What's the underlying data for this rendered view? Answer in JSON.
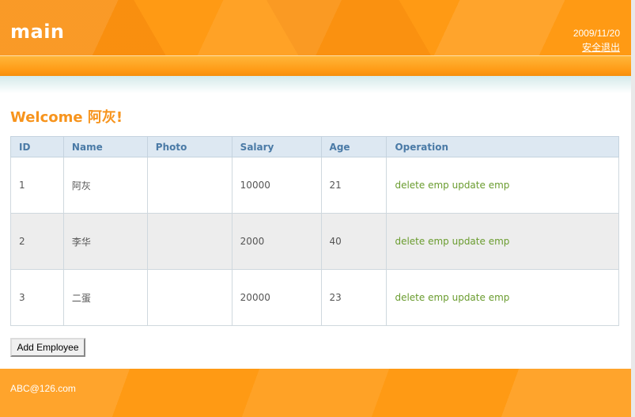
{
  "header": {
    "logo": "main",
    "date": "2009/11/20",
    "logout_label": "安全退出"
  },
  "main": {
    "welcome": "Welcome 阿灰!",
    "table": {
      "columns": [
        "ID",
        "Name",
        "Photo",
        "Salary",
        "Age",
        "Operation"
      ],
      "rows": [
        {
          "id": "1",
          "name": "阿灰",
          "photo": "",
          "salary": "10000",
          "age": "21",
          "delete": "delete emp",
          "update": "update emp"
        },
        {
          "id": "2",
          "name": "李华",
          "photo": "",
          "salary": "2000",
          "age": "40",
          "delete": "delete emp",
          "update": "update emp"
        },
        {
          "id": "3",
          "name": "二蛋",
          "photo": "",
          "salary": "20000",
          "age": "23",
          "delete": "delete emp",
          "update": "update emp"
        }
      ]
    },
    "add_button_label": "Add Employee"
  },
  "footer": {
    "email": "ABC@126.com"
  },
  "colors": {
    "brand_orange": "#ff9a14",
    "welcome_text": "#f7941d",
    "header_text_blue": "#4a7aa6",
    "link_green": "#6a9c2f"
  }
}
